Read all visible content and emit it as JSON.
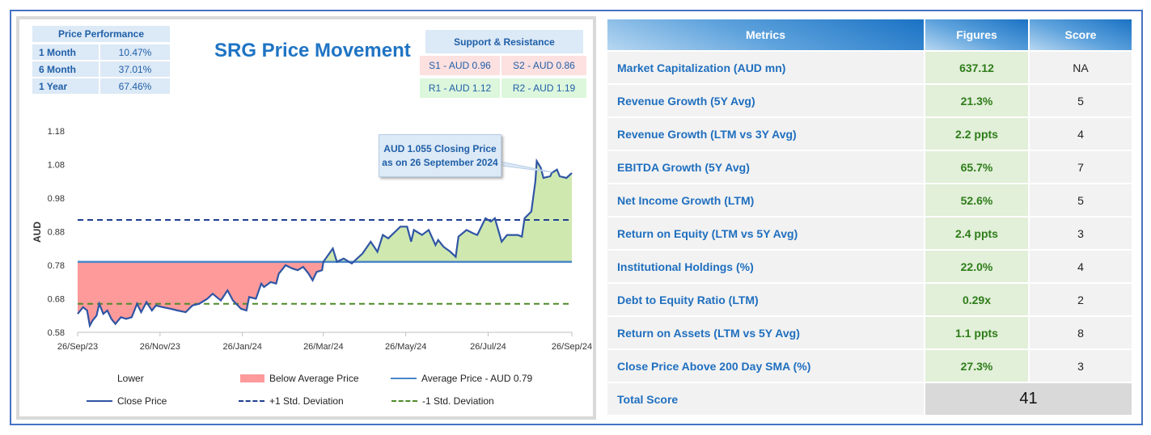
{
  "price_performance": {
    "header": "Price Performance",
    "rows": [
      {
        "label": "1 Month",
        "value": "10.47%"
      },
      {
        "label": "6 Month",
        "value": "37.01%"
      },
      {
        "label": "1 Year",
        "value": "67.46%"
      }
    ]
  },
  "title": "SRG Price Movement",
  "support_resistance": {
    "header": "Support & Resistance",
    "s1": "S1 - AUD 0.96",
    "s2": "S2 - AUD 0.86",
    "r1": "R1 - AUD 1.12",
    "r2": "R2 - AUD 1.19"
  },
  "callout": {
    "line1": "AUD 1.055 Closing Price",
    "line2": "as on 26 September 2024"
  },
  "legend": {
    "lower": "Lower",
    "below": "Below Average Price",
    "avg": "Average Price - AUD 0.79",
    "close": "Close Price",
    "plus": "+1 Std. Deviation",
    "minus": "-1 Std. Deviation"
  },
  "colors": {
    "line": "#2f55a4",
    "below": "#ff9a9a",
    "above": "#cfe8b0",
    "avg": "#4a86c8",
    "plus": "#1f3f8f",
    "minus": "#4f8a2a"
  },
  "chart_data": {
    "type": "line",
    "title": "SRG Price Movement",
    "ylabel": "AUD",
    "xlabel": "",
    "ylim": [
      0.58,
      1.18
    ],
    "yticks": [
      "0.58",
      "0.68",
      "0.78",
      "0.88",
      "0.98",
      "1.08",
      "1.18"
    ],
    "xticks": [
      "26/Sep/23",
      "26/Nov/23",
      "26/Jan/24",
      "26/Mar/24",
      "26/May/24",
      "26/Jul/24",
      "26/Sep/24"
    ],
    "xtick_days": [
      0,
      61,
      122,
      182,
      243,
      304,
      366
    ],
    "xrange_days": [
      0,
      366
    ],
    "average": 0.79,
    "plus_1sd": 0.915,
    "minus_1sd": 0.665,
    "series": [
      {
        "name": "Close Price",
        "days": [
          0,
          1,
          4,
          7,
          9,
          11,
          14,
          16,
          19,
          22,
          25,
          28,
          32,
          36,
          40,
          44,
          47,
          51,
          55,
          58,
          63,
          69,
          74,
          80,
          85,
          90,
          96,
          100,
          106,
          111,
          115,
          121,
          125,
          127,
          132,
          136,
          138,
          143,
          147,
          149,
          154,
          159,
          163,
          167,
          171,
          174,
          177,
          181,
          182,
          189,
          192,
          197,
          203,
          211,
          217,
          222,
          226,
          230,
          239,
          244,
          247,
          249,
          255,
          260,
          265,
          267,
          271,
          276,
          280,
          282,
          288,
          293,
          296,
          302,
          306,
          309,
          314,
          318,
          326,
          329,
          331,
          336,
          339,
          340,
          343,
          345,
          350,
          351,
          355,
          357,
          362,
          366
        ],
        "values": [
          0.635,
          0.64,
          0.655,
          0.645,
          0.6,
          0.615,
          0.63,
          0.665,
          0.635,
          0.645,
          0.62,
          0.605,
          0.625,
          0.62,
          0.625,
          0.665,
          0.64,
          0.67,
          0.645,
          0.66,
          0.655,
          0.65,
          0.645,
          0.64,
          0.66,
          0.665,
          0.68,
          0.695,
          0.675,
          0.705,
          0.675,
          0.65,
          0.645,
          0.685,
          0.68,
          0.725,
          0.715,
          0.73,
          0.725,
          0.755,
          0.78,
          0.77,
          0.765,
          0.775,
          0.755,
          0.735,
          0.76,
          0.765,
          0.79,
          0.83,
          0.79,
          0.8,
          0.785,
          0.815,
          0.85,
          0.82,
          0.87,
          0.86,
          0.895,
          0.895,
          0.85,
          0.885,
          0.87,
          0.885,
          0.84,
          0.855,
          0.835,
          0.82,
          0.805,
          0.865,
          0.885,
          0.875,
          0.87,
          0.92,
          0.91,
          0.92,
          0.85,
          0.87,
          0.87,
          0.865,
          0.92,
          0.94,
          1.03,
          1.09,
          1.07,
          1.04,
          1.045,
          1.055,
          1.065,
          1.045,
          1.04,
          1.055
        ]
      }
    ]
  },
  "table": {
    "headers": [
      "Metrics",
      "Figures",
      "Score"
    ],
    "rows": [
      {
        "metric": "Market Capitalization (AUD mn)",
        "figure": "637.12",
        "score": "NA"
      },
      {
        "metric": "Revenue Growth (5Y Avg)",
        "figure": "21.3%",
        "score": "5"
      },
      {
        "metric": "Revenue Growth (LTM vs 3Y Avg)",
        "figure": "2.2 ppts",
        "score": "4"
      },
      {
        "metric": "EBITDA Growth (5Y Avg)",
        "figure": "65.7%",
        "score": "7"
      },
      {
        "metric": "Net Income Growth (LTM)",
        "figure": "52.6%",
        "score": "5"
      },
      {
        "metric": "Return on Equity (LTM vs 5Y Avg)",
        "figure": "2.4 ppts",
        "score": "3"
      },
      {
        "metric": "Institutional Holdings (%)",
        "figure": "22.0%",
        "score": "4"
      },
      {
        "metric": "Debt to Equity Ratio (LTM)",
        "figure": "0.29x",
        "score": "2"
      },
      {
        "metric": "Return on Assets (LTM vs 5Y Avg)",
        "figure": "1.1 ppts",
        "score": "8"
      },
      {
        "metric": "Close Price Above 200 Day SMA (%)",
        "figure": "27.3%",
        "score": "3"
      }
    ],
    "total_label": "Total Score",
    "total_value": "41"
  }
}
